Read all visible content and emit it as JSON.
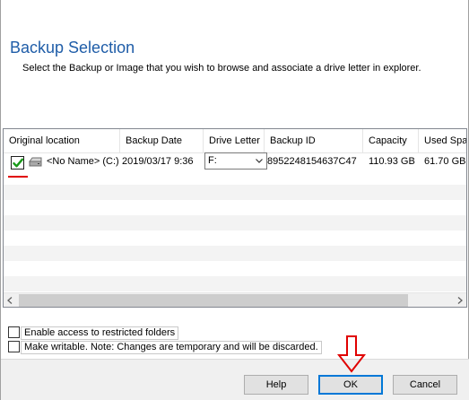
{
  "dialog": {
    "title": "Backup Selection",
    "subtitle": "Select the Backup or Image that you wish to browse and associate a drive letter in explorer."
  },
  "table": {
    "columns": [
      "Original location",
      "Backup Date",
      "Drive Letter",
      "Backup ID",
      "Capacity",
      "Used Space"
    ],
    "rows": [
      {
        "checked": true,
        "location": "<No Name> (C:)",
        "date": "2019/03/17 9:36",
        "drive_letter": "F:",
        "backup_id": "8952248154637C47",
        "capacity": "110.93 GB",
        "used": "61.70 GB"
      }
    ]
  },
  "options": {
    "restricted": "Enable access to restricted folders",
    "writable": "Make writable. Note: Changes are temporary and will be discarded."
  },
  "buttons": {
    "help": "Help",
    "ok": "OK",
    "cancel": "Cancel"
  },
  "colors": {
    "title": "#1f5da8",
    "annotation": "#e00000",
    "check": "#1a9a1a"
  }
}
